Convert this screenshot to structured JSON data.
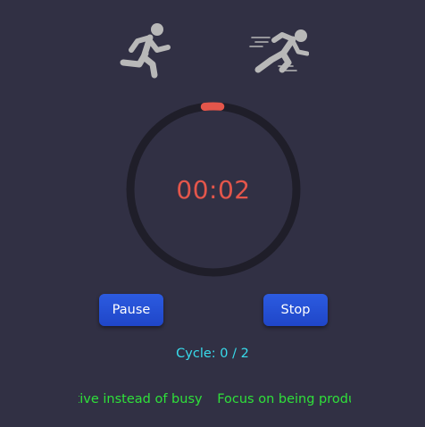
{
  "timer": {
    "time": "00:02",
    "progress_fraction": 0.03
  },
  "buttons": {
    "pause_label": "Pause",
    "stop_label": "Stop"
  },
  "cycle": {
    "text": "Cycle: 0 / 2"
  },
  "ticker": {
    "messages": [
      "Be productive instead of busy",
      "Focus on being productive"
    ]
  },
  "icons": {
    "left": "running-person-icon",
    "right": "sprinting-person-icon"
  },
  "colors": {
    "background": "#313044",
    "ring_track": "#1f1e29",
    "ring_progress": "#e4564b",
    "time_text": "#e4564b",
    "button": "#2350d6",
    "cycle_text": "#38dcec",
    "ticker_text": "#2fe03a",
    "icon": "#b8b8b8"
  }
}
